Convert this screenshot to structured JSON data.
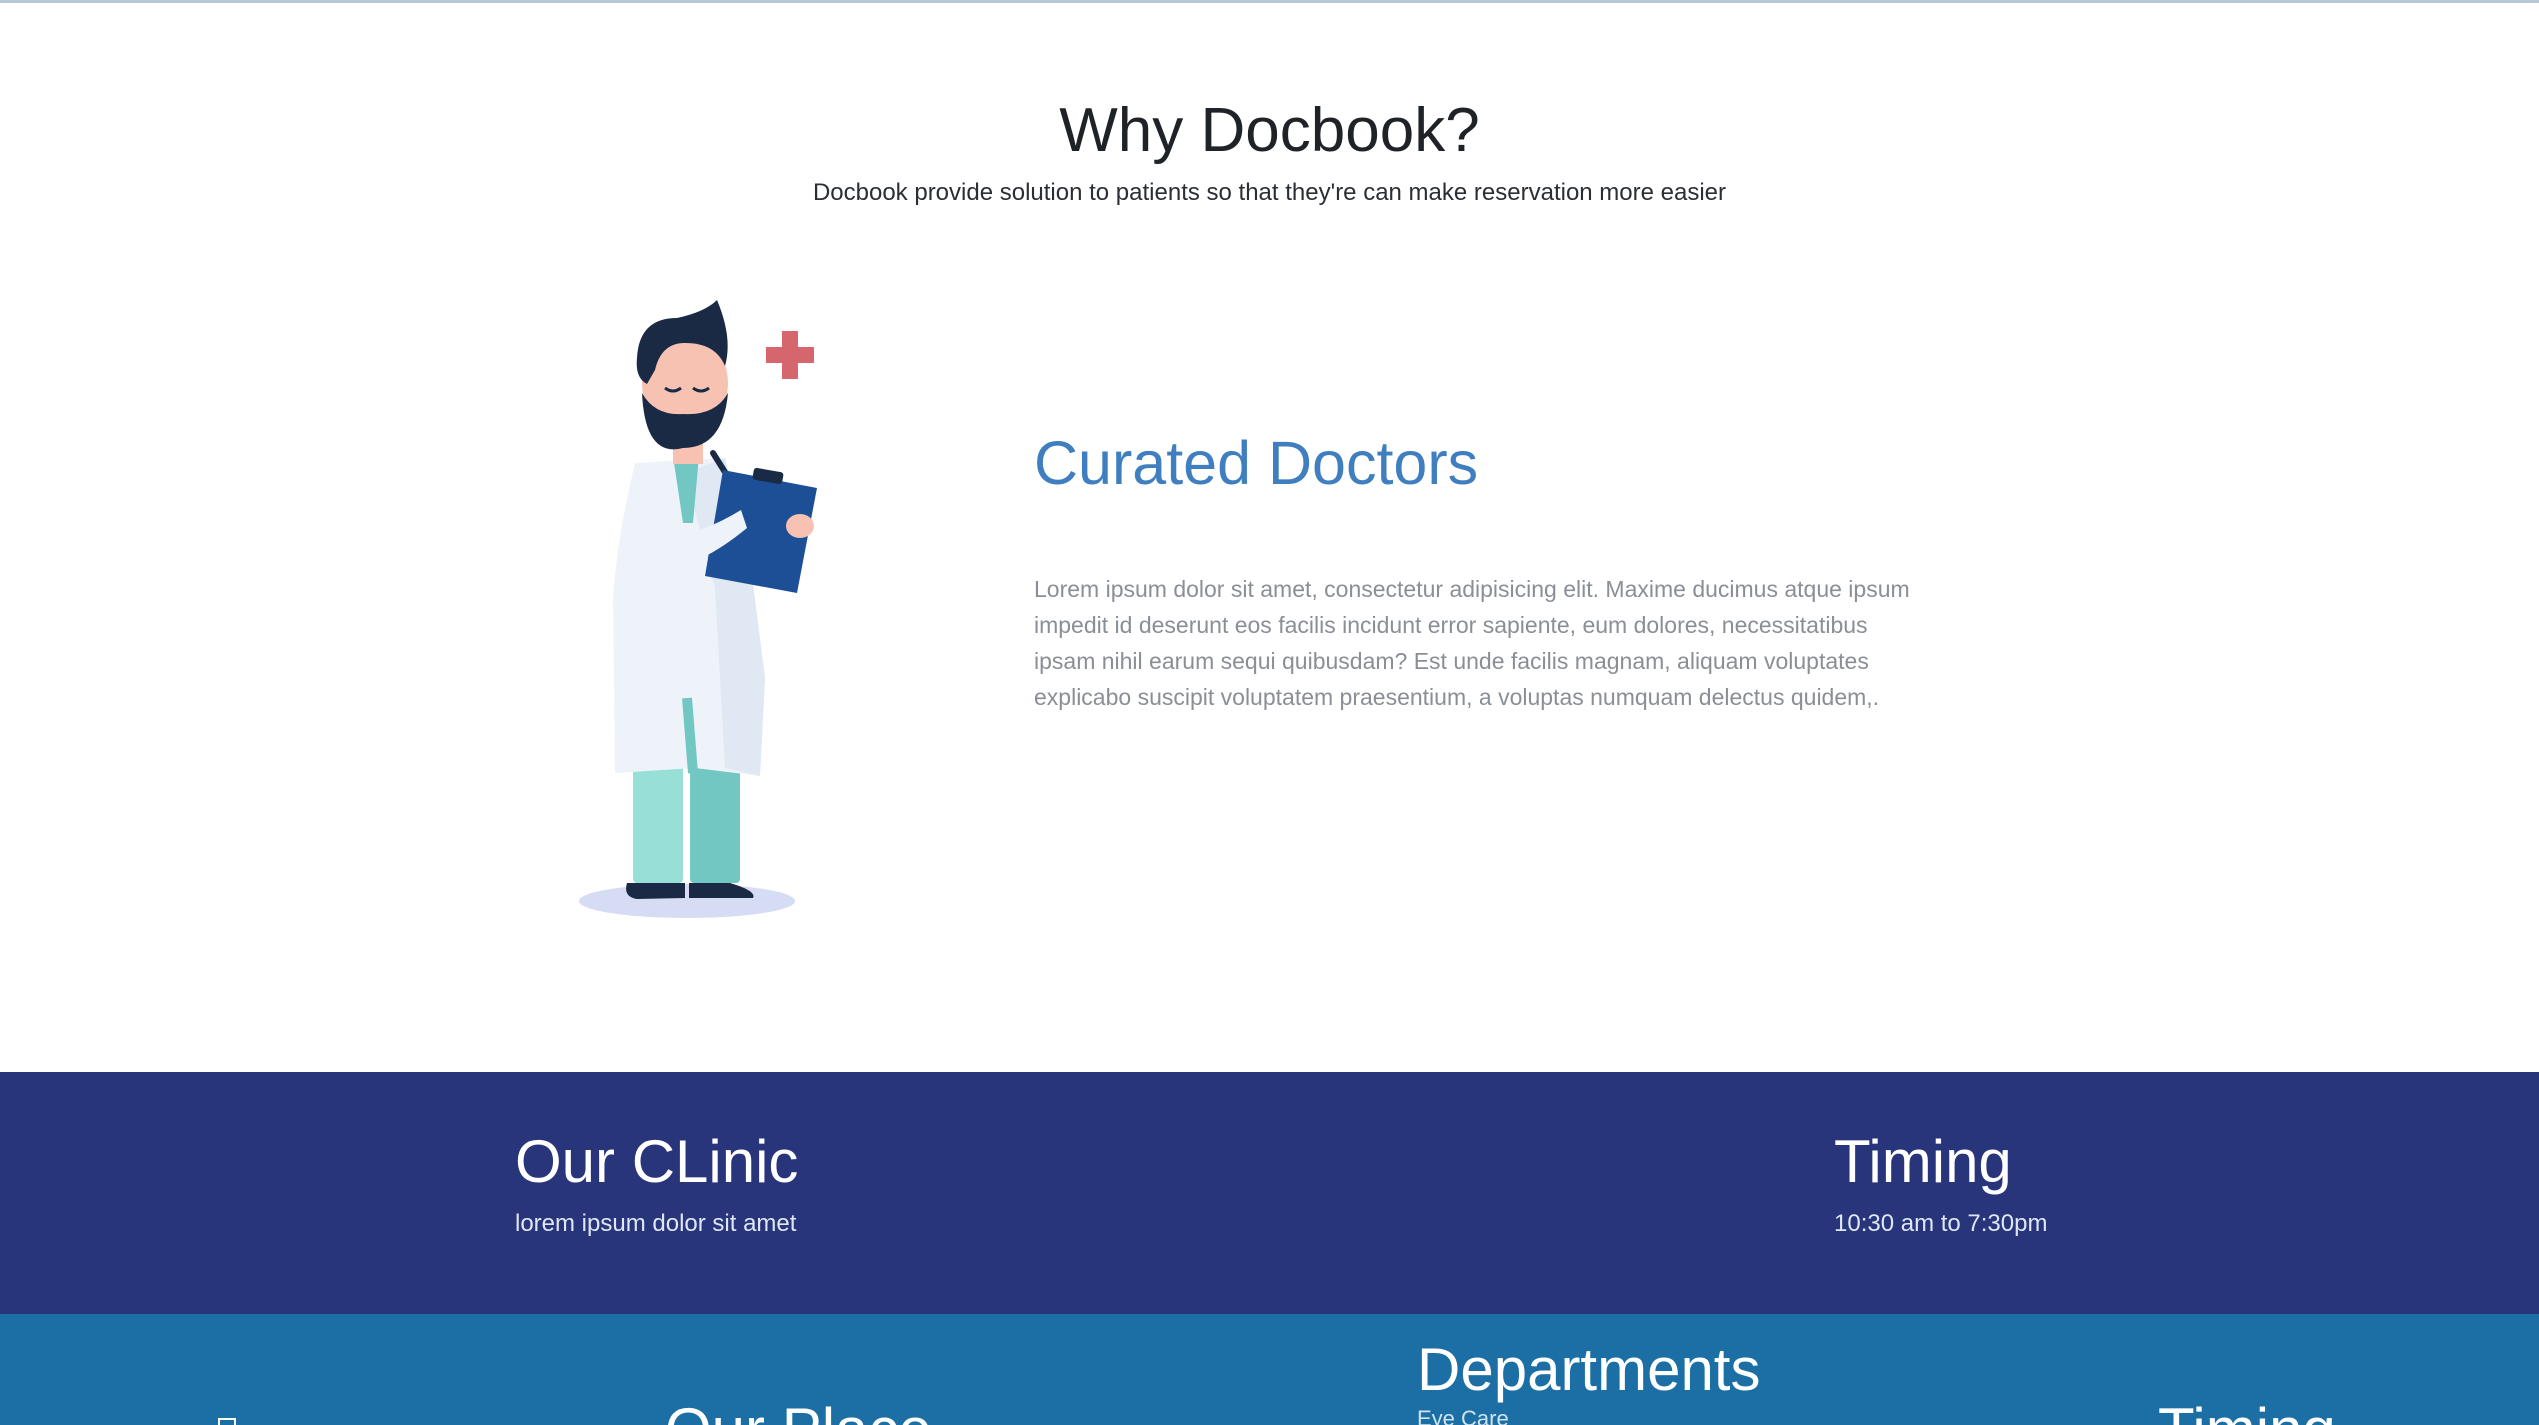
{
  "why": {
    "title": "Why Docbook?",
    "subtitle": "Docbook provide solution to patients so that they're can make reservation more easier"
  },
  "feature": {
    "title": "Curated Doctors",
    "description": "Lorem ipsum dolor sit amet, consectetur adipisicing elit. Maxime ducimus atque ipsum impedit id deserunt eos facilis incidunt error sapiente, eum dolores, necessitatibus ipsam nihil earum sequi quibusdam? Est unde facilis magnam, aliquam voluptates explicabo suscipit voluptatem praesentium, a voluptas numquam delectus quidem,."
  },
  "clinic_bar": {
    "clinic_title": "Our CLinic",
    "clinic_text": "lorem ipsum dolor sit amet",
    "timing_title": "Timing",
    "timing_text": "10:30 am to 7:30pm"
  },
  "footer": {
    "place_title": "Our Place",
    "departments_title": "Departments",
    "departments_first_item": "Eye Care",
    "timing_title": "Timing"
  },
  "colors": {
    "accent": "#3f7fc0",
    "clinic_bar": "#28357a",
    "footer_bar": "#1c6fa5"
  },
  "icons": [
    "doctor-illustration",
    "medical-cross-icon"
  ]
}
